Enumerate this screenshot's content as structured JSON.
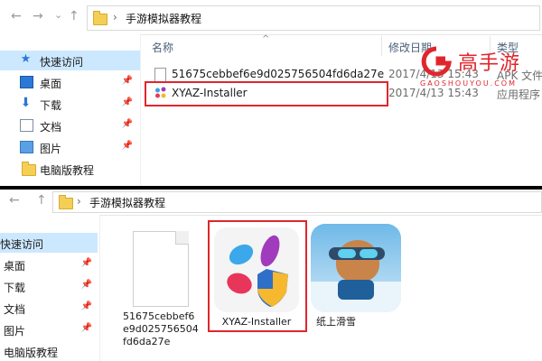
{
  "top": {
    "path": "手游模拟器教程",
    "columns": {
      "name": "名称",
      "date": "修改日期",
      "type": "类型"
    },
    "sidebar": [
      {
        "label": "快速访问",
        "icon": "star-icon"
      },
      {
        "label": "桌面",
        "icon": "desktop-icon"
      },
      {
        "label": "下载",
        "icon": "download-icon"
      },
      {
        "label": "文档",
        "icon": "document-icon"
      },
      {
        "label": "图片",
        "icon": "pictures-icon"
      },
      {
        "label": "电脑版教程",
        "icon": "folder-icon"
      }
    ],
    "files": [
      {
        "name": "51675cebbef6e9d025756504fd6da27e",
        "date": "2017/4/13 15:43",
        "type": "APK 文件"
      },
      {
        "name": "XYAZ-Installer",
        "date": "2017/4/13 15:43",
        "type": "应用程序"
      }
    ]
  },
  "bottom": {
    "path": "手游模拟器教程",
    "sidebar": [
      {
        "label": "快速访问"
      },
      {
        "label": "桌面"
      },
      {
        "label": "下载"
      },
      {
        "label": "文档"
      },
      {
        "label": "图片"
      },
      {
        "label": "电脑版教程"
      }
    ],
    "tiles": [
      {
        "caption": "51675cebbef6e9d025756504fd6da27e",
        "icon": "blank-file-icon"
      },
      {
        "caption": "XYAZ-Installer",
        "icon": "xyaz-installer-icon"
      },
      {
        "caption": "纸上滑雪",
        "icon": "ski-game-icon"
      }
    ]
  },
  "watermark": {
    "name": "高手游",
    "url": "GAOSHOUYOU.COM"
  },
  "colors": {
    "selection": "#cce8ff",
    "highlight_box": "#e0262d",
    "brand_red": "#e0262d"
  }
}
